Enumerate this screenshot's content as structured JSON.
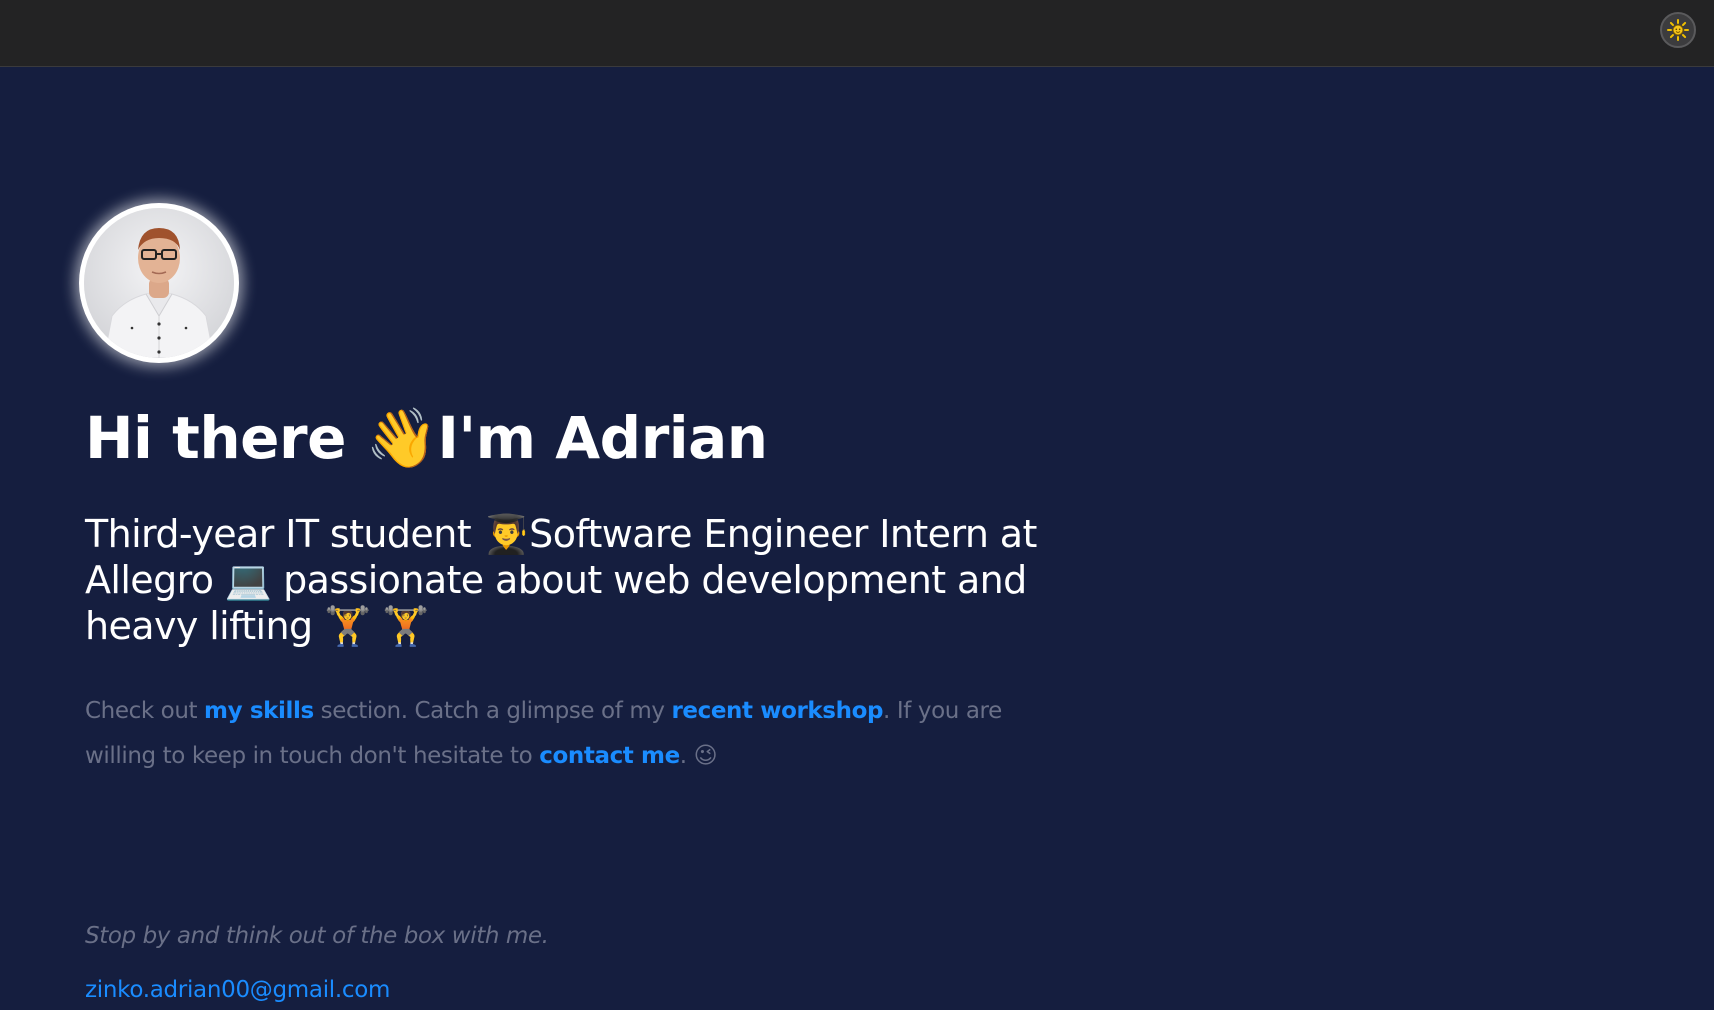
{
  "header": {
    "theme_toggle_icon": "sun-icon"
  },
  "profile": {
    "avatar": "profile-photo"
  },
  "hero": {
    "greeting": "Hi there 👋I'm Adrian",
    "subtitle": "Third-year IT student 👨‍🎓Software Engineer Intern at Allegro 💻 passionate about web development and heavy lifting 🏋️ 🏋️"
  },
  "intro": {
    "part1": "Check out ",
    "link_skills": "my skills",
    "part2": " section. Catch a glimpse of my ",
    "link_workshop": "recent workshop",
    "part3": ". If you are willing to keep in touch don't hesitate to ",
    "link_contact": "contact me",
    "part4": ". 😉"
  },
  "footer": {
    "quote": "Stop by and think out of the box with me.",
    "email": "zinko.adrian00@gmail.com"
  },
  "colors": {
    "background": "#151e3f",
    "topbar": "#232324",
    "link": "#1a8cff",
    "muted_text": "#6a7088"
  }
}
